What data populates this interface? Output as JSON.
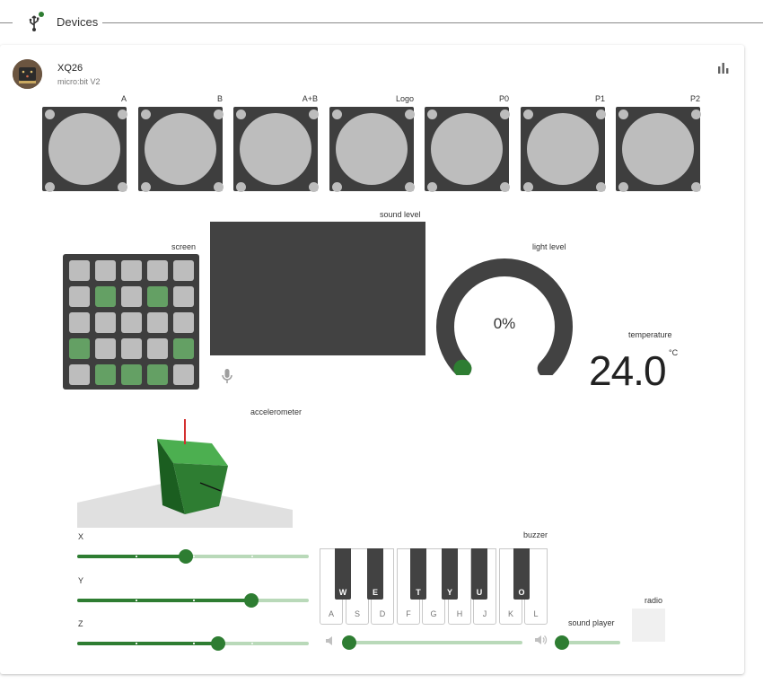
{
  "header": {
    "title": "Devices",
    "icon": "usb-icon",
    "status_color": "#2e7d32"
  },
  "device": {
    "name": "XQ26",
    "model": "micro:bit V2",
    "chart_icon": "bar-chart-icon"
  },
  "buttons": [
    {
      "label": "A"
    },
    {
      "label": "B"
    },
    {
      "label": "A+B"
    },
    {
      "label": "Logo"
    },
    {
      "label": "P0"
    },
    {
      "label": "P1"
    },
    {
      "label": "P2"
    }
  ],
  "screen": {
    "label": "screen",
    "leds": [
      [
        0,
        0,
        0,
        0,
        0
      ],
      [
        0,
        1,
        0,
        1,
        0
      ],
      [
        0,
        0,
        0,
        0,
        0
      ],
      [
        1,
        0,
        0,
        0,
        1
      ],
      [
        0,
        1,
        1,
        1,
        0
      ]
    ]
  },
  "sound_level": {
    "label": "sound level",
    "mic_icon": "microphone-icon"
  },
  "light_level": {
    "label": "light level",
    "value": "0%",
    "fraction": 0.0
  },
  "temperature": {
    "label": "temperature",
    "value": "24.0",
    "unit": "°C"
  },
  "accelerometer": {
    "label": "accelerometer",
    "sliders": [
      {
        "label": "X",
        "fraction": 0.47
      },
      {
        "label": "Y",
        "fraction": 0.75
      },
      {
        "label": "Z",
        "fraction": 0.61
      }
    ]
  },
  "buzzer": {
    "label": "buzzer",
    "white_keys": [
      "A",
      "S",
      "D",
      "F",
      "G",
      "H",
      "J",
      "K",
      "L"
    ],
    "black_keys": [
      "W",
      "E",
      "T",
      "Y",
      "U",
      "O"
    ],
    "volume_fraction": 0.0
  },
  "sound_player": {
    "label": "sound player",
    "volume_fraction": 0.0
  },
  "radio": {
    "label": "radio"
  },
  "colors": {
    "accent": "#2e7d32",
    "dark": "#424242",
    "led_off": "#bdbdbd",
    "led_on": "#64a064"
  }
}
